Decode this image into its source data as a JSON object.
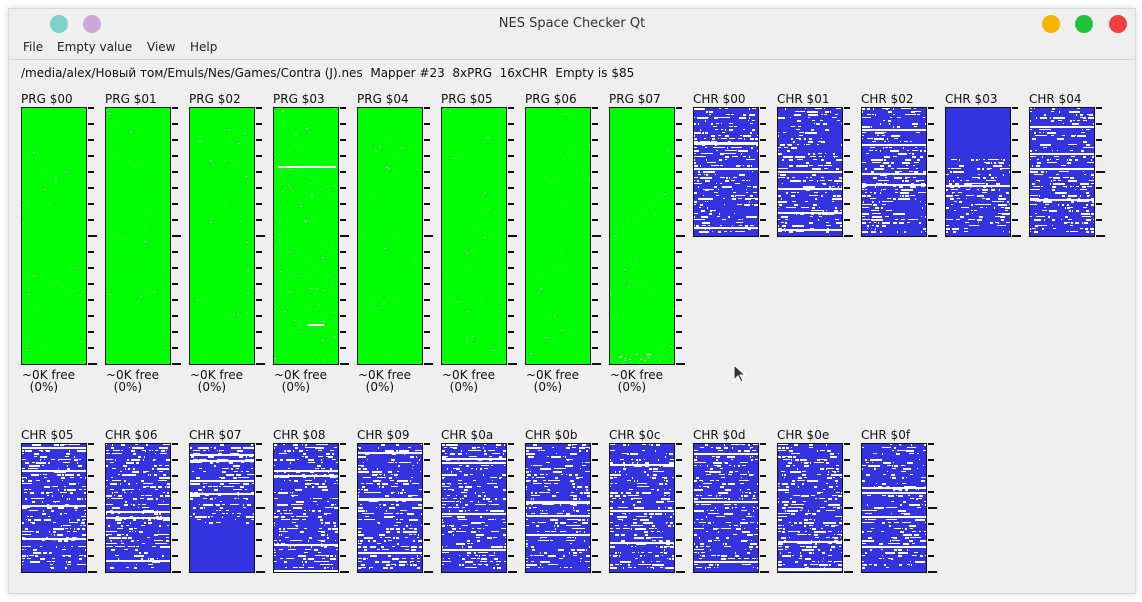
{
  "window": {
    "title": "NES Space Checker Qt",
    "buttons": {
      "left": [
        "#7fd2c9",
        "#c9a7d6"
      ],
      "minimize": "#f5b400",
      "maximize": "#21c13a",
      "close": "#ee4040"
    }
  },
  "menu": [
    "File",
    "Empty value",
    "View",
    "Help"
  ],
  "info": {
    "path": "/media/alex/Новый том/Emuls/Nes/Games/Contra (J).nes",
    "mapper": "Mapper #23",
    "prg_count": "8xPRG",
    "chr_count": "16xCHR",
    "empty": "Empty is $85"
  },
  "colors": {
    "prg_fill": "#00ff00",
    "chr_fill": "#3333e0",
    "empty": "#ffffff",
    "border": "#111111"
  },
  "prg_banks": [
    {
      "label": "PRG $00",
      "free": "~0K free",
      "percent": "(0%)"
    },
    {
      "label": "PRG $01",
      "free": "~0K free",
      "percent": "(0%)"
    },
    {
      "label": "PRG $02",
      "free": "~0K free",
      "percent": "(0%)"
    },
    {
      "label": "PRG $03",
      "free": "~0K free",
      "percent": "(0%)"
    },
    {
      "label": "PRG $04",
      "free": "~0K free",
      "percent": "(0%)"
    },
    {
      "label": "PRG $05",
      "free": "~0K free",
      "percent": "(0%)"
    },
    {
      "label": "PRG $06",
      "free": "~0K free",
      "percent": "(0%)"
    },
    {
      "label": "PRG $07",
      "free": "~0K free",
      "percent": "(0%)"
    }
  ],
  "chr_banks": [
    {
      "label": "CHR $00"
    },
    {
      "label": "CHR $01"
    },
    {
      "label": "CHR $02"
    },
    {
      "label": "CHR $03"
    },
    {
      "label": "CHR $04"
    },
    {
      "label": "CHR $05"
    },
    {
      "label": "CHR $06"
    },
    {
      "label": "CHR $07"
    },
    {
      "label": "CHR $08"
    },
    {
      "label": "CHR $09"
    },
    {
      "label": "CHR $0a"
    },
    {
      "label": "CHR $0b"
    },
    {
      "label": "CHR $0c"
    },
    {
      "label": "CHR $0d"
    },
    {
      "label": "CHR $0e"
    },
    {
      "label": "CHR $0f"
    }
  ]
}
